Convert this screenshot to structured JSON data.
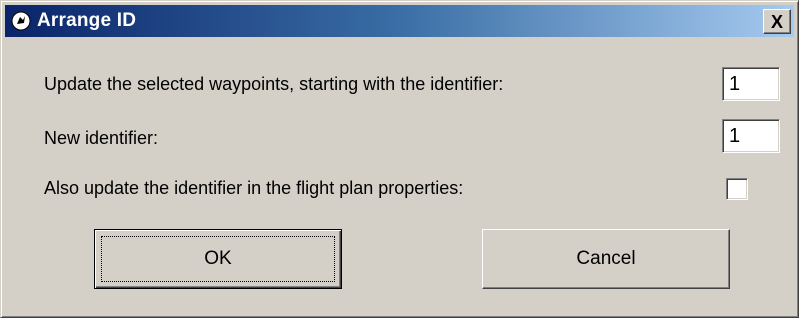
{
  "window": {
    "title": "Arrange ID",
    "close_symbol": "X",
    "icon": "app-logo-icon"
  },
  "form": {
    "start_identifier": {
      "label": "Update the selected waypoints, starting with the identifier:",
      "value": "1"
    },
    "new_identifier": {
      "label": "New identifier:",
      "value": "1"
    },
    "update_flight_plan": {
      "label": "Also update the identifier in the flight plan properties:",
      "checked": false
    }
  },
  "buttons": {
    "ok_label": "OK",
    "cancel_label": "Cancel"
  },
  "colors": {
    "titlebar_start": "#0a246a",
    "titlebar_end": "#a6caf0",
    "dialog_face": "#d4d0c8"
  }
}
